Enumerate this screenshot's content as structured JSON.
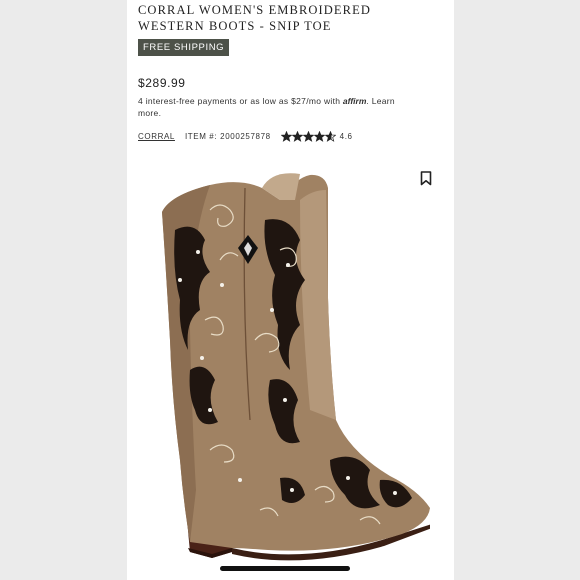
{
  "product": {
    "title": "CORRAL WOMEN'S EMBROIDERED WESTERN BOOTS - SNIP TOE",
    "badge": "FREE SHIPPING",
    "price": "$289.99",
    "financing_pre": "4 interest-free payments or as low as $27/mo with ",
    "financing_logo": "affirm",
    "financing_post": ". Learn",
    "financing_more": "more.",
    "brand": "CORRAL",
    "item_label": "ITEM #:",
    "item_number": "2000257878",
    "rating": "4.6",
    "rating_value": 4.6,
    "rating_max": 5
  },
  "icons": {
    "bookmark": "bookmark-icon",
    "star": "star-icon"
  },
  "colors": {
    "badge_bg": "#4d5249",
    "background": "#ebebeb",
    "card": "#ffffff",
    "star": "#222222"
  }
}
